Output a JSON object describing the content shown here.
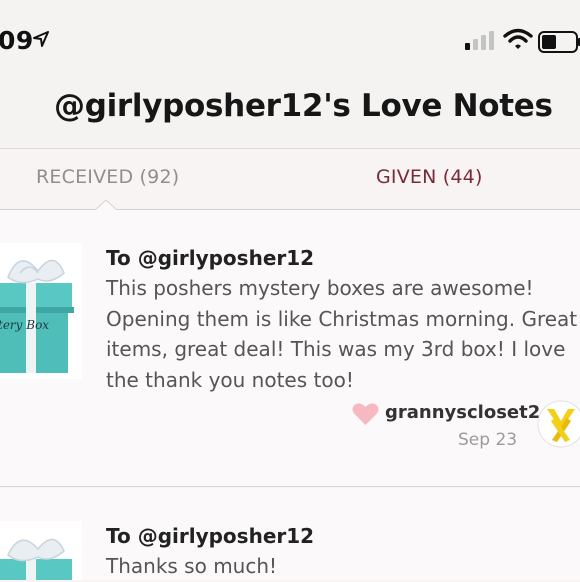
{
  "status_bar": {
    "time": "09",
    "icons": [
      "location-arrow-icon",
      "cellular-signal-icon",
      "wifi-icon",
      "battery-icon"
    ]
  },
  "header": {
    "title": "@girlyposher12's Love Notes"
  },
  "tabs": [
    {
      "label": "RECEIVED (92)",
      "selected": true
    },
    {
      "label": "GIVEN (44)",
      "selected": false
    }
  ],
  "colors": {
    "given_tab": "#7a2a38",
    "heart": "#f6b9c2",
    "gift_box": "#59c7c2"
  },
  "notes": [
    {
      "recipient": "To @girlyposher12",
      "message": "This poshers mystery boxes are awesome!\nOpening them is like Christmas morning. Great\nitems, great deal! This was my 3rd box! I love\nthe thank you notes too!",
      "image_text": "tery Box",
      "sender": "grannyscloset2",
      "date": "Sep 23"
    },
    {
      "recipient": "To @girlyposher12",
      "message": "Thanks so much!"
    }
  ]
}
